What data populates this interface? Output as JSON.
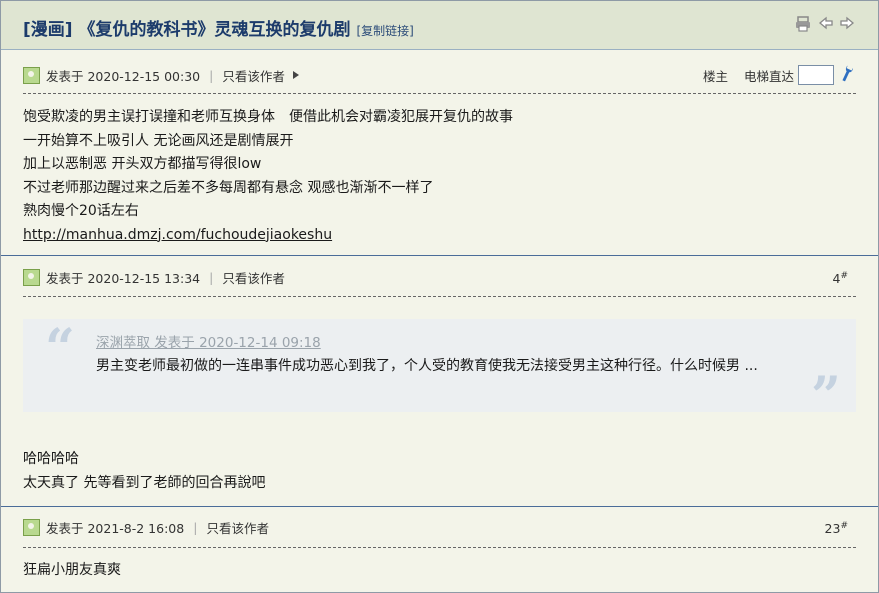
{
  "thread": {
    "title": "[漫画] 《复仇的教科书》灵魂互换的复仇剧",
    "copy_link": "[复制链接]"
  },
  "toolbar": {
    "icons": [
      "print-icon",
      "prev-arrow-icon",
      "next-arrow-icon"
    ]
  },
  "op_controls": {
    "floor_label": "楼主",
    "jump_label": "电梯直达",
    "jump_value": ""
  },
  "posts": [
    {
      "posted": "发表于 2020-12-15 00:30",
      "author_only": "只看该作者",
      "lines": [
        "饱受欺凌的男主误打误撞和老师互换身体　便借此机会对霸凌犯展开复仇的故事",
        "一开始算不上吸引人  无论画风还是剧情展开",
        "加上以恶制恶  开头双方都描写得很low",
        "不过老师那边醒过来之后差不多每周都有悬念 观感也渐渐不一样了",
        "熟肉慢个20话左右"
      ],
      "link": "http://manhua.dmzj.com/fuchoudejiaokeshu"
    },
    {
      "posted": "发表于 2020-12-15 13:34",
      "author_only": "只看该作者",
      "floor_num": "4",
      "floor_sup": "#",
      "quote": {
        "header": "深渊萃取 发表于 2020-12-14 09:18",
        "text": "男主变老师最初做的一连串事件成功恶心到我了，个人受的教育使我无法接受男主这种行径。什么时候男 ..."
      },
      "lines": [
        "哈哈哈哈",
        "太天真了 先等看到了老師的回合再說吧"
      ]
    },
    {
      "posted": "发表于 2021-8-2 16:08",
      "author_only": "只看该作者",
      "floor_num": "23",
      "floor_sup": "#",
      "lines": [
        "狂扁小朋友真爽"
      ]
    }
  ]
}
